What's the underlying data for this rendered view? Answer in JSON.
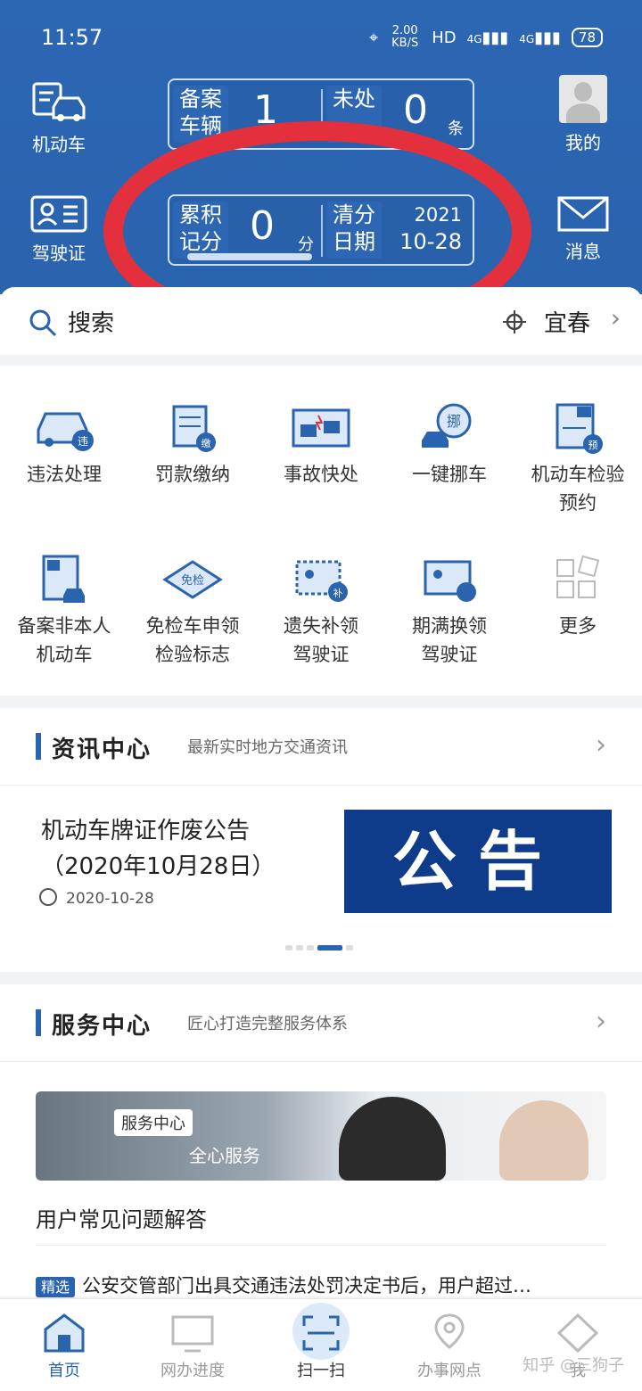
{
  "status_bar": {
    "time": "11:57",
    "network_speed": "2.00 KB/S",
    "hd": "HD",
    "signal1": "4G",
    "signal2": "4G",
    "battery": "78"
  },
  "header": {
    "vehicle_label": "机动车",
    "license_label": "驾驶证",
    "mine_label": "我的",
    "message_label": "消息",
    "card1": {
      "left_label": "备案车辆",
      "left_value": "1",
      "right_label": "未处",
      "right_value": "0",
      "right_unit": "条"
    },
    "card2": {
      "left_label": "累积记分",
      "left_value": "0",
      "left_unit": "分",
      "right_label": "清分日期",
      "date_year": "2021",
      "date_md": "10-28"
    },
    "accent": "#2a63ae",
    "ring_color": "#e4303c"
  },
  "search": {
    "label": "搜索",
    "city": "宜春"
  },
  "services": [
    {
      "label": "违法处理",
      "icon": "violation-car-icon"
    },
    {
      "label": "罚款缴纳",
      "icon": "fine-payment-icon"
    },
    {
      "label": "事故快处",
      "icon": "accident-icon"
    },
    {
      "label": "一键挪车",
      "icon": "move-car-icon"
    },
    {
      "label": "机动车检验预约",
      "icon": "inspection-booking-icon"
    },
    {
      "label": "备案非本人机动车",
      "icon": "register-vehicle-icon"
    },
    {
      "label": "免检车申领检验标志",
      "icon": "exempt-inspection-icon"
    },
    {
      "label": "遗失补领驾驶证",
      "icon": "lost-license-icon"
    },
    {
      "label": "期满换领驾驶证",
      "icon": "renew-license-icon"
    },
    {
      "label": "更多",
      "icon": "more-grid-icon"
    }
  ],
  "news": {
    "title": "资讯中心",
    "subtitle": "最新实时地方交通资讯",
    "item_title_line1": "机动车牌证作废公告",
    "item_title_line2": "（2020年10月28日）",
    "item_date": "2020-10-28",
    "banner_text": "公告"
  },
  "service_center": {
    "title": "服务中心",
    "subtitle": "匠心打造完整服务体系",
    "image_chip": "服务中心",
    "image_slogan": "全心服务",
    "faq_heading": "用户常见问题解答",
    "faq_tag": "精选",
    "faq_text": "公安交管部门出具交通违法处罚决定书后，用户超过…"
  },
  "tabbar": {
    "home": "首页",
    "progress": "网办进度",
    "scan": "扫一扫",
    "outlets": "办事网点",
    "fifth": "我",
    "watermark": "知乎 @三狗子"
  }
}
